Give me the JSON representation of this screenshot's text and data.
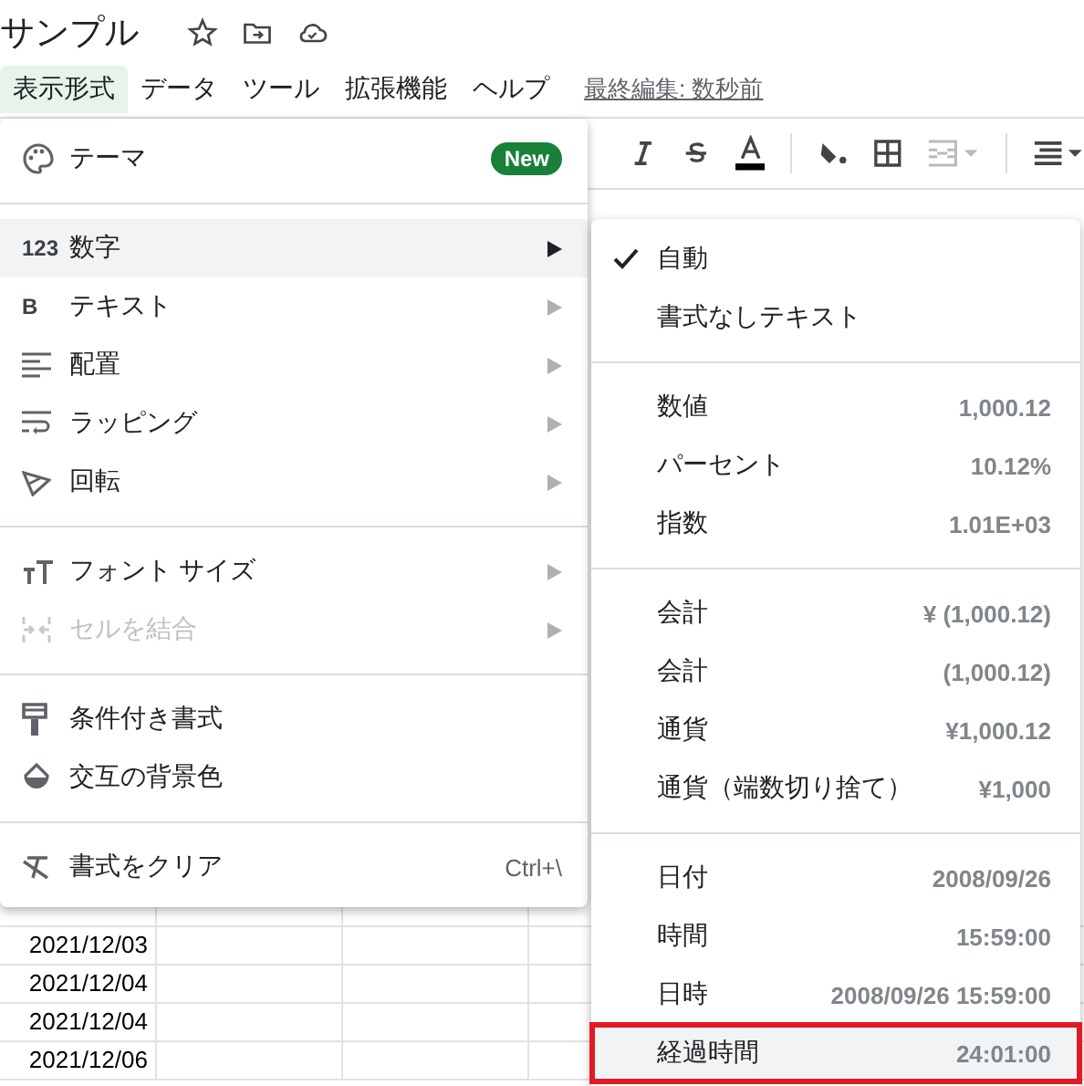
{
  "document": {
    "title": "サンプル"
  },
  "menubar": {
    "items": [
      {
        "label": "表示形式",
        "selected": true
      },
      {
        "label": "データ",
        "selected": false
      },
      {
        "label": "ツール",
        "selected": false
      },
      {
        "label": "拡張機能",
        "selected": false
      },
      {
        "label": "ヘルプ",
        "selected": false
      }
    ],
    "last_edit": "最終編集: 数秒前"
  },
  "format_menu": {
    "sections": [
      [
        {
          "kind": "palette",
          "label": "テーマ",
          "badge": "New",
          "submenu": false,
          "disabled": false,
          "hovered": false
        }
      ],
      [
        {
          "kind": "text",
          "icon_text": "123",
          "label": "数字",
          "submenu": true,
          "disabled": false,
          "hovered": true
        },
        {
          "kind": "text",
          "icon_text": "B",
          "label": "テキスト",
          "submenu": true,
          "disabled": false,
          "hovered": false
        },
        {
          "kind": "align",
          "label": "配置",
          "submenu": true,
          "disabled": false,
          "hovered": false
        },
        {
          "kind": "wrap",
          "label": "ラッピング",
          "submenu": true,
          "disabled": false,
          "hovered": false
        },
        {
          "kind": "rotate",
          "label": "回転",
          "submenu": true,
          "disabled": false,
          "hovered": false
        }
      ],
      [
        {
          "kind": "fontsize",
          "label": "フォント サイズ",
          "submenu": true,
          "disabled": false,
          "hovered": false
        },
        {
          "kind": "merge",
          "label": "セルを結合",
          "submenu": true,
          "disabled": true,
          "hovered": false
        }
      ],
      [
        {
          "kind": "roller",
          "label": "条件付き書式",
          "submenu": false,
          "disabled": false,
          "hovered": false
        },
        {
          "kind": "drop",
          "label": "交互の背景色",
          "submenu": false,
          "disabled": false,
          "hovered": false
        }
      ],
      [
        {
          "kind": "clear",
          "label": "書式をクリア",
          "shortcut": "Ctrl+\\",
          "submenu": false,
          "disabled": false,
          "hovered": false
        }
      ]
    ]
  },
  "number_menu": {
    "sections": [
      [
        {
          "label": "自動",
          "checked": true,
          "highlighted": false
        },
        {
          "label": "書式なしテキスト",
          "checked": false,
          "highlighted": false
        }
      ],
      [
        {
          "label": "数値",
          "example": "1,000.12",
          "checked": false,
          "highlighted": false
        },
        {
          "label": "パーセント",
          "example": "10.12%",
          "checked": false,
          "highlighted": false
        },
        {
          "label": "指数",
          "example": "1.01E+03",
          "checked": false,
          "highlighted": false
        }
      ],
      [
        {
          "label": "会計",
          "example": "¥ (1,000.12)",
          "checked": false,
          "highlighted": false
        },
        {
          "label": "会計",
          "example": "(1,000.12)",
          "checked": false,
          "highlighted": false
        },
        {
          "label": "通貨",
          "example": "¥1,000.12",
          "checked": false,
          "highlighted": false
        },
        {
          "label": "通貨（端数切り捨て）",
          "example": "¥1,000",
          "checked": false,
          "highlighted": false
        }
      ],
      [
        {
          "label": "日付",
          "example": "2008/09/26",
          "checked": false,
          "highlighted": false
        },
        {
          "label": "時間",
          "example": "15:59:00",
          "checked": false,
          "highlighted": false
        },
        {
          "label": "日時",
          "example": "2008/09/26 15:59:00",
          "checked": false,
          "highlighted": false
        },
        {
          "label": "経過時間",
          "example": "24:01:00",
          "checked": false,
          "highlighted": true
        }
      ]
    ]
  },
  "sheet": {
    "rows": [
      {
        "column_a": "2021/12/03"
      },
      {
        "column_a": "2021/12/04"
      },
      {
        "column_a": "2021/12/04"
      },
      {
        "column_a": "2021/12/06"
      }
    ]
  }
}
